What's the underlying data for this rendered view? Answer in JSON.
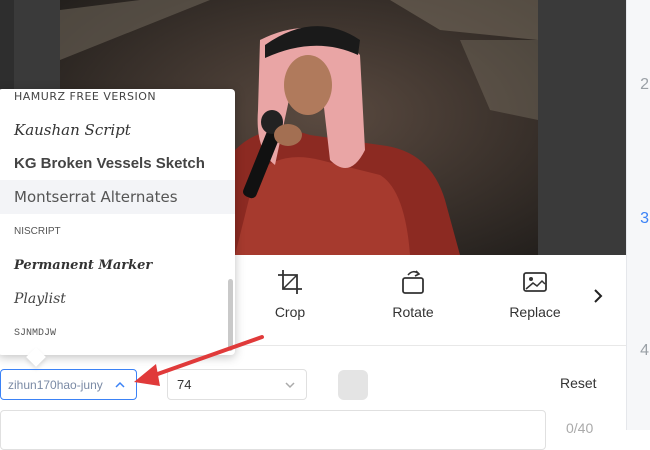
{
  "gutter": {
    "numbers": [
      "2",
      "3",
      "4"
    ]
  },
  "toolbar": {
    "crop_label": "Crop",
    "rotate_label": "Rotate",
    "replace_label": "Replace"
  },
  "font_dropdown": {
    "options": [
      "HAMURZ FREE VERSION",
      "Kaushan Script",
      "KG Broken Vessels Sketch",
      "Montserrat Alternates",
      "NISCRIPT",
      "Permanent Marker",
      "Playlist",
      "SJNMDJW"
    ],
    "hovered": "Montserrat Alternates"
  },
  "controls": {
    "font_value": "zihun170hao-juny",
    "size_value": "74",
    "reset_label": "Reset",
    "char_count": "0/40"
  },
  "colors": {
    "accent": "#3b82f6",
    "annotation_arrow": "#e03a3a"
  }
}
